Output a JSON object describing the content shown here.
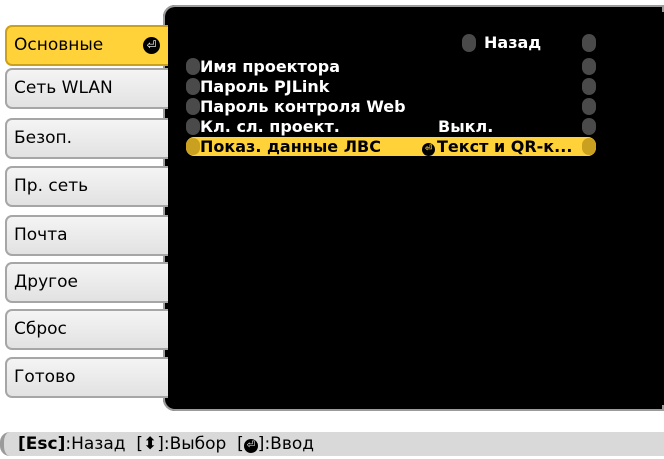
{
  "sidebar": {
    "items": [
      {
        "label": "Основные",
        "active": true
      },
      {
        "label": "Сеть WLAN",
        "active": false
      },
      {
        "label": "Безоп.",
        "active": false
      },
      {
        "label": "Пр. сеть",
        "active": false
      },
      {
        "label": "Почта",
        "active": false
      },
      {
        "label": "Другое",
        "active": false
      },
      {
        "label": "Сброс",
        "active": false
      },
      {
        "label": "Готово",
        "active": false
      }
    ],
    "enter_icon": "enter-icon"
  },
  "main": {
    "back_label": "Назад",
    "rows": [
      {
        "label": "Имя проектора",
        "value": ""
      },
      {
        "label": "Пароль PJLink",
        "value": ""
      },
      {
        "label": "Пароль контроля Web",
        "value": ""
      },
      {
        "label": "Кл. сл. проект.",
        "value": "Выкл."
      },
      {
        "label": "Показ. данные ЛВС",
        "value": "Текст и QR-к..."
      }
    ],
    "selected_row": 4
  },
  "footer": {
    "esc_key": "[Esc]",
    "esc_action": ":Назад",
    "select_open": "[",
    "select_close": "]",
    "select_action": ":Выбор",
    "enter_open": "[",
    "enter_close": "]",
    "enter_action": ":Ввод"
  },
  "colors": {
    "accent": "#ffd23a",
    "panel": "#000000",
    "footer_bg": "#d9d9d9"
  }
}
